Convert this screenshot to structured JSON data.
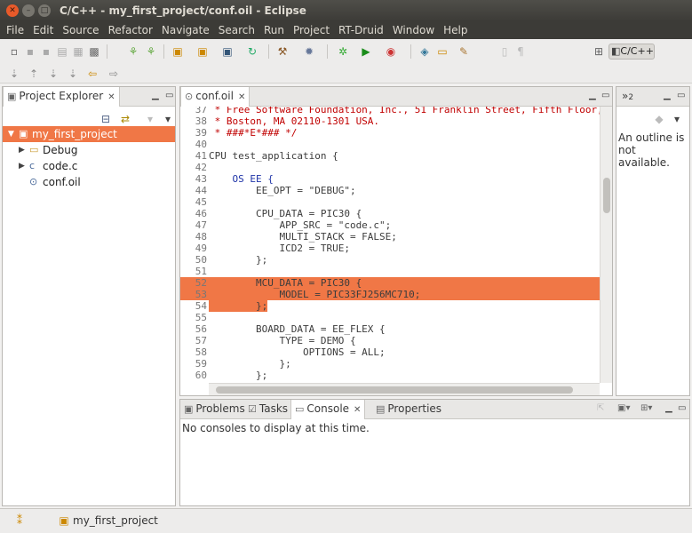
{
  "window": {
    "title": "C/C++ - my_first_project/conf.oil - Eclipse"
  },
  "menu": [
    "File",
    "Edit",
    "Source",
    "Refactor",
    "Navigate",
    "Search",
    "Run",
    "Project",
    "RT-Druid",
    "Window",
    "Help"
  ],
  "toolbar": {
    "perspective_label": "C/C++"
  },
  "project_explorer": {
    "tab_label": "Project Explorer",
    "items": [
      {
        "label": "my_first_project",
        "type": "project",
        "expanded": true,
        "selected": true
      },
      {
        "label": "Debug",
        "type": "folder",
        "expanded": false
      },
      {
        "label": "code.c",
        "type": "c-file",
        "expanded": false
      },
      {
        "label": "conf.oil",
        "type": "oil-file"
      }
    ]
  },
  "editor": {
    "tab_label": "conf.oil",
    "lines": [
      {
        "n": "37",
        "text": " * Free Software Foundation, Inc., 51 Franklin Street, Fifth Floor,",
        "kind": "comment"
      },
      {
        "n": "38",
        "text": " * Boston, MA 02110-1301 USA.",
        "kind": "comment"
      },
      {
        "n": "39",
        "text": " * ###*E*### */",
        "kind": "comment"
      },
      {
        "n": "40",
        "text": "",
        "kind": "plain"
      },
      {
        "n": "41",
        "text": "CPU test_application {",
        "kind": "plain"
      },
      {
        "n": "42",
        "text": "",
        "kind": "plain"
      },
      {
        "n": "43",
        "text": "    OS EE {",
        "kind": "os"
      },
      {
        "n": "44",
        "text": "        EE_OPT = \"DEBUG\";",
        "kind": "plain"
      },
      {
        "n": "45",
        "text": "",
        "kind": "plain"
      },
      {
        "n": "46",
        "text": "        CPU_DATA = PIC30 {",
        "kind": "plain"
      },
      {
        "n": "47",
        "text": "            APP_SRC = \"code.c\";",
        "kind": "plain"
      },
      {
        "n": "48",
        "text": "            MULTI_STACK = FALSE;",
        "kind": "plain"
      },
      {
        "n": "49",
        "text": "            ICD2 = TRUE;",
        "kind": "plain"
      },
      {
        "n": "50",
        "text": "        };",
        "kind": "plain"
      },
      {
        "n": "51",
        "text": "",
        "kind": "plain"
      },
      {
        "n": "52",
        "text": "        MCU_DATA = PIC30 {",
        "kind": "hl-full"
      },
      {
        "n": "53",
        "text": "            MODEL = PIC33FJ256MC710;",
        "kind": "hl-full"
      },
      {
        "n": "54",
        "text": "        };",
        "kind": "hl-part"
      },
      {
        "n": "55",
        "text": "",
        "kind": "plain"
      },
      {
        "n": "56",
        "text": "        BOARD_DATA = EE_FLEX {",
        "kind": "plain"
      },
      {
        "n": "57",
        "text": "            TYPE = DEMO {",
        "kind": "plain"
      },
      {
        "n": "58",
        "text": "                OPTIONS = ALL;",
        "kind": "plain"
      },
      {
        "n": "59",
        "text": "            };",
        "kind": "plain"
      },
      {
        "n": "60",
        "text": "        };",
        "kind": "plain"
      }
    ]
  },
  "outline": {
    "tab_label": "2",
    "message": "An outline is not available."
  },
  "bottom_panel": {
    "tabs": [
      "Problems",
      "Tasks",
      "Console",
      "Properties"
    ],
    "active_tab": "Console",
    "message": "No consoles to display at this time."
  },
  "status": {
    "project": "my_first_project"
  },
  "colors": {
    "selection": "#f07746",
    "comment": "#c00000",
    "keyword": "#1f34a8",
    "string": "#2a00ff"
  }
}
